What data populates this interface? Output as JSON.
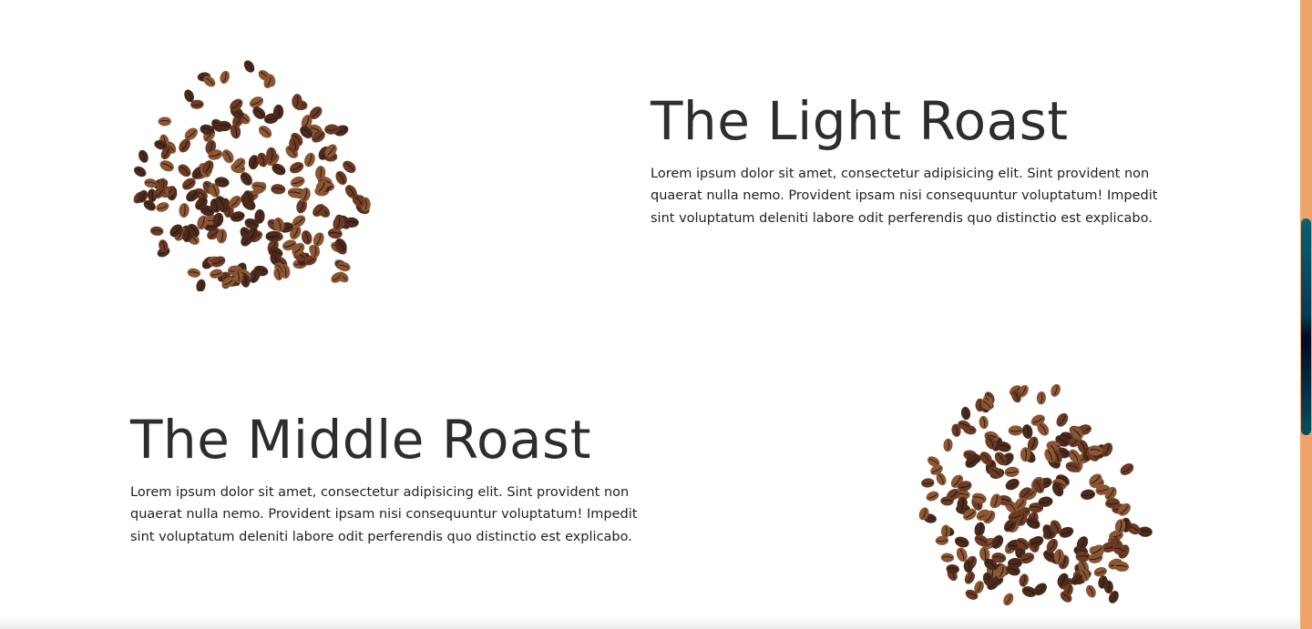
{
  "sections": [
    {
      "title": "The Light Roast",
      "description": "Lorem ipsum dolor sit amet, consectetur adipisicing elit. Sint provident non quaerat nulla nemo. Provident ipsam nisi consequuntur voluptatum! Impedit sint voluptatum deleniti labore odit perferendis quo distinctio est explicabo.",
      "image": "coffee-beans-image"
    },
    {
      "title": "The Middle Roast",
      "description": "Lorem ipsum dolor sit amet, consectetur adipisicing elit. Sint provident non quaerat nulla nemo. Provident ipsam nisi consequuntur voluptatum! Impedit sint voluptatum deleniti labore odit perferendis quo distinctio est explicabo.",
      "image": "coffee-beans-image"
    }
  ],
  "colors": {
    "accent_bar": "#efa46a",
    "text": "#2e2b2b",
    "bean_dark": "#4a2a1c",
    "bean_mid": "#6b3b25",
    "bean_light": "#8a5634"
  }
}
